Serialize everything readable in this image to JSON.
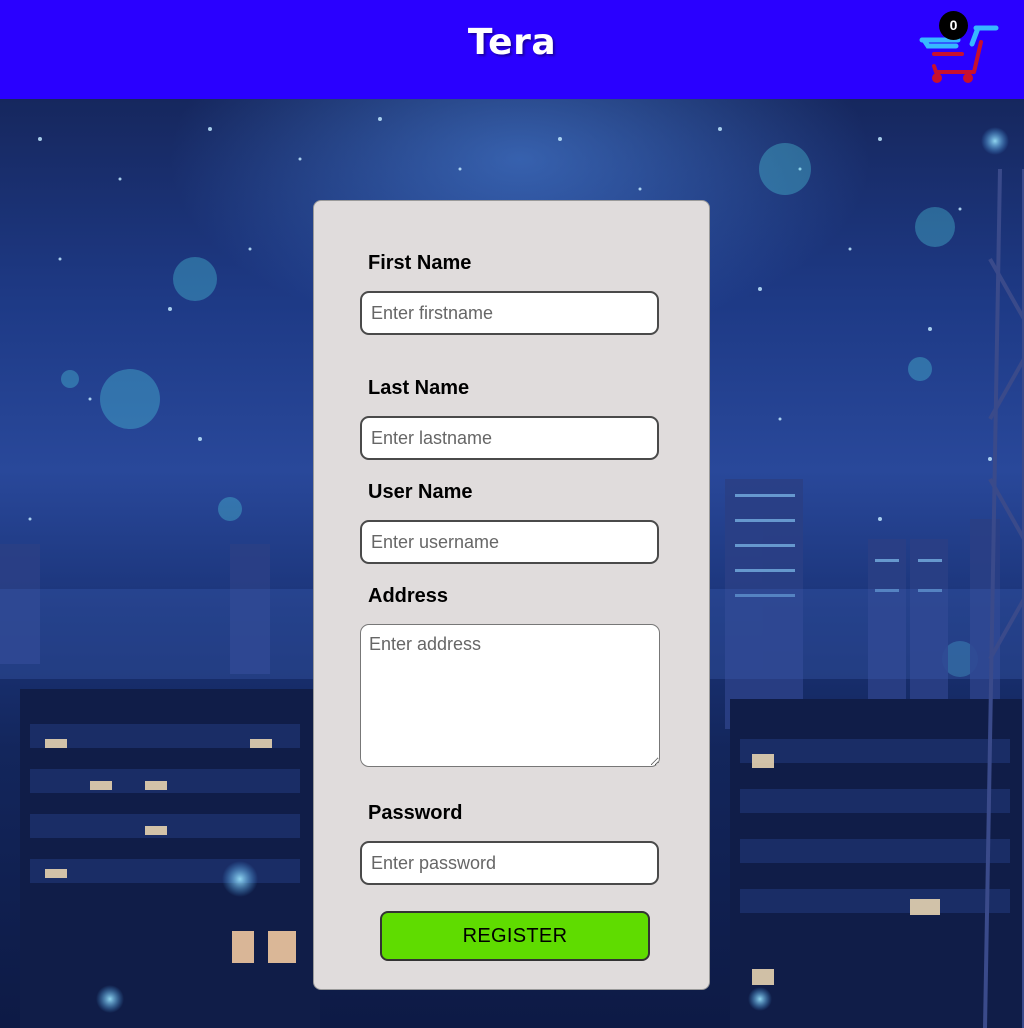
{
  "header": {
    "brand": "Tera",
    "cart_count": "0",
    "background_color": "#2a00ff"
  },
  "form": {
    "first_name_label": "First Name",
    "first_name_placeholder": "Enter firstname",
    "last_name_label": "Last Name",
    "last_name_placeholder": "Enter lastname",
    "user_name_label": "User Name",
    "user_name_placeholder": "Enter username",
    "address_label": "Address",
    "address_placeholder": "Enter address",
    "password_label": "Password",
    "password_placeholder": "Enter password",
    "register_label": "REGISTER",
    "register_color": "#5fdc00",
    "card_color": "#e0dcdc"
  },
  "icons": {
    "cart": "shopping-cart-icon"
  }
}
